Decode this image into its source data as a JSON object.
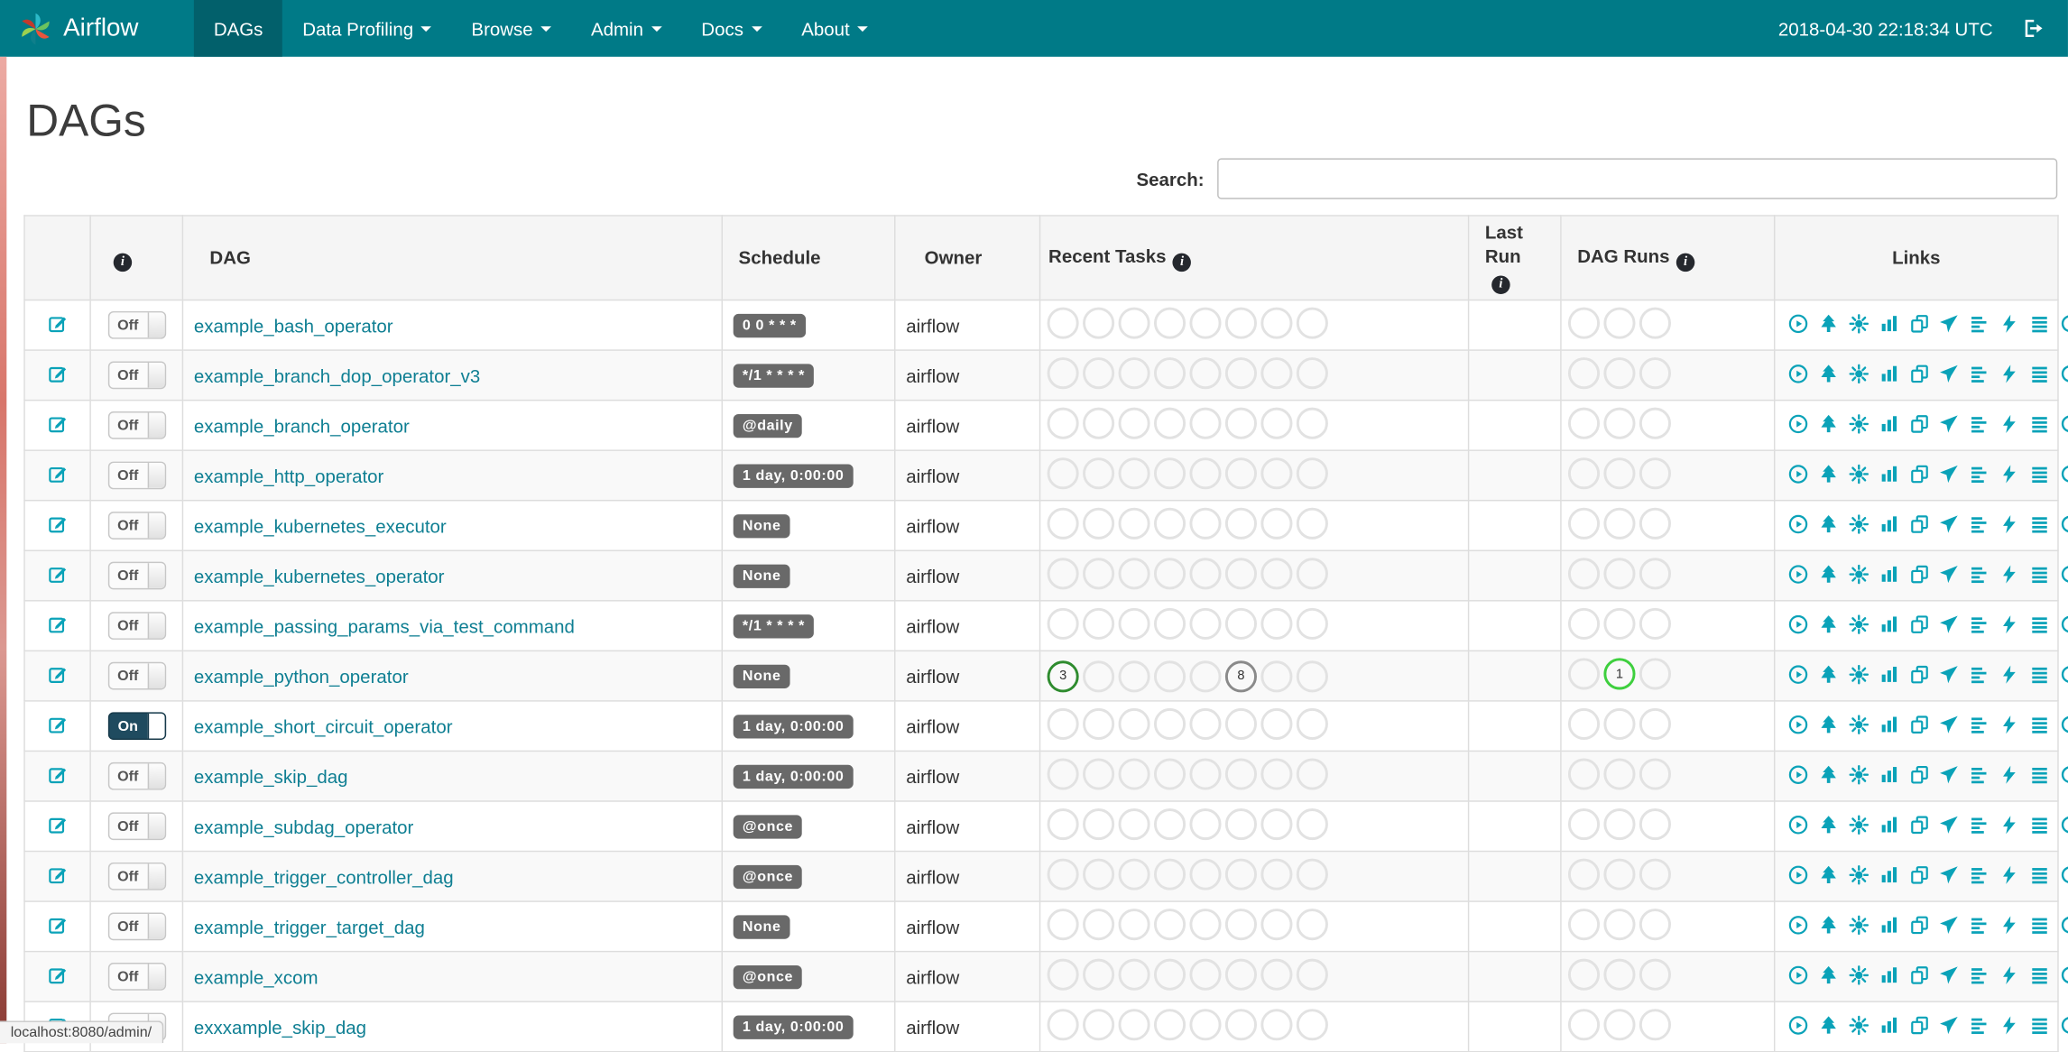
{
  "navbar": {
    "brand": "Airflow",
    "items": [
      {
        "label": "DAGs",
        "active": true,
        "has_menu": false
      },
      {
        "label": "Data Profiling",
        "active": false,
        "has_menu": true
      },
      {
        "label": "Browse",
        "active": false,
        "has_menu": true
      },
      {
        "label": "Admin",
        "active": false,
        "has_menu": true
      },
      {
        "label": "Docs",
        "active": false,
        "has_menu": true
      },
      {
        "label": "About",
        "active": false,
        "has_menu": true
      }
    ],
    "clock": "2018-04-30 22:18:34 UTC"
  },
  "page": {
    "title": "DAGs"
  },
  "search": {
    "label": "Search:",
    "value": ""
  },
  "icons": {
    "info_glyph": "i"
  },
  "colors": {
    "navbar": "#007a87",
    "navbar_active": "#02606b",
    "dag_link": "#0f7f93",
    "action_icon": "#0aa2b8",
    "badge_bg": "#696969",
    "empty_circle_border": "#e2e2e2",
    "success_green": "#2e8b2e",
    "running_lime": "#3ecf3e",
    "grey_state": "#8a8a8a",
    "toggle_on_bg": "#1f4b5f"
  },
  "table": {
    "headers": {
      "dag": "DAG",
      "schedule": "Schedule",
      "owner": "Owner",
      "recent_tasks": "Recent Tasks",
      "last_run": "Last Run",
      "dag_runs": "DAG Runs",
      "links": "Links"
    },
    "link_actions": [
      "trigger-dag",
      "tree-view",
      "graph-view",
      "task-duration",
      "task-tries",
      "landing-times",
      "gantt-view",
      "code-view",
      "logs",
      "refresh"
    ],
    "rows": [
      {
        "dag_id": "example_bash_operator",
        "toggle": "Off",
        "schedule": "0 0 * * *",
        "owner": "airflow"
      },
      {
        "dag_id": "example_branch_dop_operator_v3",
        "toggle": "Off",
        "schedule": "*/1 * * * *",
        "owner": "airflow"
      },
      {
        "dag_id": "example_branch_operator",
        "toggle": "Off",
        "schedule": "@daily",
        "owner": "airflow"
      },
      {
        "dag_id": "example_http_operator",
        "toggle": "Off",
        "schedule": "1 day, 0:00:00",
        "owner": "airflow"
      },
      {
        "dag_id": "example_kubernetes_executor",
        "toggle": "Off",
        "schedule": "None",
        "owner": "airflow"
      },
      {
        "dag_id": "example_kubernetes_operator",
        "toggle": "Off",
        "schedule": "None",
        "owner": "airflow"
      },
      {
        "dag_id": "example_passing_params_via_test_command",
        "toggle": "Off",
        "schedule": "*/1 * * * *",
        "owner": "airflow"
      },
      {
        "dag_id": "example_python_operator",
        "toggle": "Off",
        "schedule": "None",
        "owner": "airflow",
        "recent_tasks": [
          {
            "count": 3,
            "color": "#2e8b2e"
          },
          null,
          null,
          null,
          null,
          {
            "count": 8,
            "color": "#8a8a8a"
          },
          null,
          null
        ],
        "dag_runs": [
          null,
          {
            "count": 1,
            "color": "#3ecf3e"
          },
          null
        ]
      },
      {
        "dag_id": "example_short_circuit_operator",
        "toggle": "On",
        "schedule": "1 day, 0:00:00",
        "owner": "airflow"
      },
      {
        "dag_id": "example_skip_dag",
        "toggle": "Off",
        "schedule": "1 day, 0:00:00",
        "owner": "airflow"
      },
      {
        "dag_id": "example_subdag_operator",
        "toggle": "Off",
        "schedule": "@once",
        "owner": "airflow"
      },
      {
        "dag_id": "example_trigger_controller_dag",
        "toggle": "Off",
        "schedule": "@once",
        "owner": "airflow"
      },
      {
        "dag_id": "example_trigger_target_dag",
        "toggle": "Off",
        "schedule": "None",
        "owner": "airflow"
      },
      {
        "dag_id": "example_xcom",
        "toggle": "Off",
        "schedule": "@once",
        "owner": "airflow"
      },
      {
        "dag_id": "exxxample_skip_dag",
        "toggle": "Off",
        "schedule": "1 day, 0:00:00",
        "owner": "airflow"
      }
    ]
  },
  "statusbar": {
    "text": "localhost:8080/admin/"
  }
}
